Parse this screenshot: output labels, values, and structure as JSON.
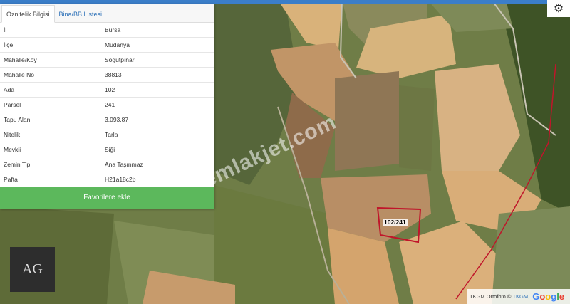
{
  "tabs": {
    "active": "Öznitelik Bilgisi",
    "other": "Bina/BB Listesi"
  },
  "attributes": [
    {
      "key": "İl",
      "value": "Bursa"
    },
    {
      "key": "İlçe",
      "value": "Mudanya"
    },
    {
      "key": "Mahalle/Köy",
      "value": "Söğütpınar"
    },
    {
      "key": "Mahalle No",
      "value": "38813"
    },
    {
      "key": "Ada",
      "value": "102"
    },
    {
      "key": "Parsel",
      "value": "241"
    },
    {
      "key": "Tapu Alanı",
      "value": "3.093,87"
    },
    {
      "key": "Nitelik",
      "value": "Tarla"
    },
    {
      "key": "Mevkii",
      "value": "Siği"
    },
    {
      "key": "Zemin Tip",
      "value": "Ana Taşınmaz"
    },
    {
      "key": "Pafta",
      "value": "H21a18c2b"
    }
  ],
  "favorite_button": "Favorilere ekle",
  "parcel_label": "102/241",
  "watermark": "emlakjet.com",
  "attribution": {
    "text": "TKGM Ortofoto ©",
    "link": "TKGM,",
    "google": "Google"
  },
  "icons": {
    "settings": "gear-icon"
  },
  "colors": {
    "button": "#5cb85c",
    "parcel_outline": "#c0152a",
    "link": "#2a6fb7"
  }
}
